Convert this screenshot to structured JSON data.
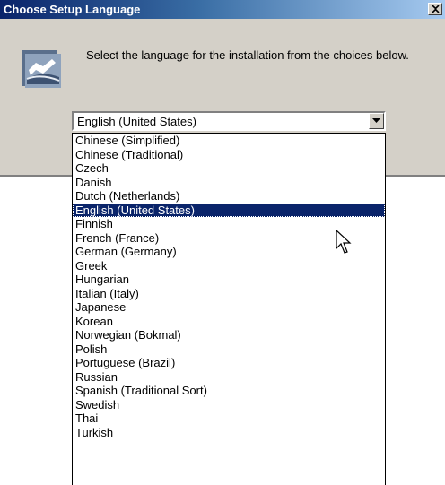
{
  "window": {
    "title": "Choose Setup Language",
    "close_icon": "close-icon"
  },
  "content": {
    "icon": "setup-icon",
    "instruction": "Select the language for the installation from the choices below."
  },
  "language_select": {
    "selected_value": "English (United States)",
    "arrow_icon": "chevron-down-icon",
    "highlighted_index": 5,
    "options": [
      "Chinese (Simplified)",
      "Chinese (Traditional)",
      "Czech",
      "Danish",
      "Dutch (Netherlands)",
      "English (United States)",
      "Finnish",
      "French (France)",
      "German (Germany)",
      "Greek",
      "Hungarian",
      "Italian (Italy)",
      "Japanese",
      "Korean",
      "Norwegian (Bokmal)",
      "Polish",
      "Portuguese (Brazil)",
      "Russian",
      "Spanish (Traditional Sort)",
      "Swedish",
      "Thai",
      "Turkish"
    ]
  },
  "colors": {
    "titlebar_start": "#0a246a",
    "titlebar_end": "#a6caf0",
    "dialog_face": "#d4d0c8",
    "selection": "#0a246a"
  }
}
